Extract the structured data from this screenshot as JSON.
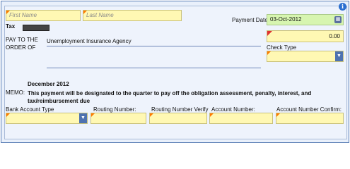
{
  "payee": {
    "first_name_placeholder": "First Name",
    "last_name_placeholder": "Last Name",
    "tax_label": "Tax",
    "pay_to_line1": "PAY TO THE",
    "pay_to_line2": "ORDER OF",
    "payee_name": "Unemployment Insurance Agency"
  },
  "payment": {
    "date_label": "Payment Date:",
    "date_value": "03-Oct-2012",
    "amount_value": "0.00",
    "check_type_label": "Check Type",
    "check_type_value": ""
  },
  "memo": {
    "period": "December 2012",
    "label": "MEMO:",
    "text": "This payment will be designated to the quarter to pay off the obligation assessment, penalty, interest, and tax/reimbursement due"
  },
  "bank": {
    "account_type_label": "Bank Account Type",
    "routing_label": "Routing Number:",
    "routing_verify_label": "Routing Number Verify",
    "account_number_label": "Account Number:",
    "account_confirm_label": "Account Number Confirm:"
  },
  "icons": {
    "info": "info-icon",
    "calendar": "calendar-icon",
    "dropdown": "chevron-down-icon"
  }
}
